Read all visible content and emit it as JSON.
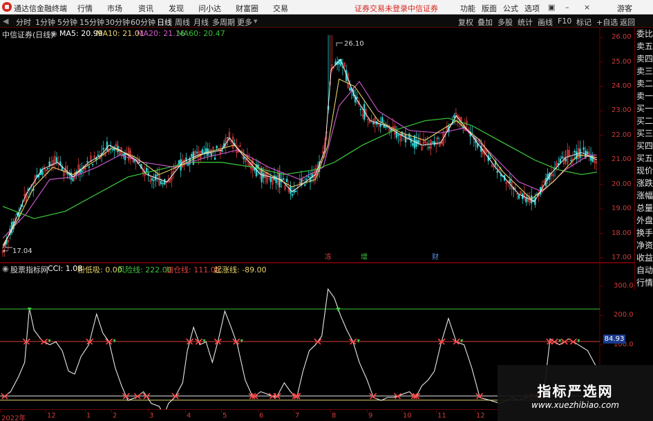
{
  "menubar": {
    "app_title": "通达信金融终端",
    "items": [
      "行情",
      "市场",
      "资讯",
      "发现",
      "问小达",
      "财富圈",
      "交易"
    ],
    "status_text": "证券交易未登录",
    "broker": "中信证券",
    "right_items": [
      "功能",
      "版面",
      "公式",
      "选项"
    ],
    "user": "游客"
  },
  "toolbar": {
    "periods": [
      "分时",
      "1分钟",
      "5分钟",
      "15分钟",
      "30分钟",
      "60分钟",
      "日线",
      "周线",
      "月线",
      "多周期",
      "更多"
    ],
    "active_period": "日线",
    "right_tools": [
      "复权",
      "叠加",
      "多股",
      "统计",
      "画线",
      "F10",
      "标记",
      "+自选",
      "返回"
    ]
  },
  "main_chart": {
    "stock_label": "中信证券(日线)",
    "ma_labels": [
      {
        "text": "MA5: 20.99",
        "color": "#ffffff"
      },
      {
        "text": "MA10: 21.01",
        "color": "#e8d36a"
      },
      {
        "text": "MA20: 21.16",
        "color": "#d25cd2"
      },
      {
        "text": "MA60: 20.47",
        "color": "#38c038"
      }
    ],
    "high_marker": "26.10",
    "low_marker": "17.04",
    "event_markers": [
      {
        "text": "冻",
        "color": "#e04040"
      },
      {
        "text": "增",
        "color": "#40c040"
      },
      {
        "text": "财",
        "color": "#5a8ce0"
      }
    ],
    "y_ticks": [
      "26.00",
      "25.00",
      "24.00",
      "23.00",
      "22.00",
      "21.00",
      "20.00",
      "19.00",
      "18.00",
      "17.00"
    ]
  },
  "sidebar": {
    "items": [
      "委比",
      "卖五",
      "卖四",
      "卖三",
      "卖二",
      "卖一",
      "买一",
      "买二",
      "买三",
      "买四",
      "买五",
      "现价",
      "涨跌",
      "涨幅",
      "总量",
      "外盘",
      "换手",
      "净资",
      "收益",
      "自动",
      "行情"
    ]
  },
  "indicator": {
    "name": "股票指标网",
    "legend": [
      {
        "text": "CCI: 1.08",
        "color": "#ffffff"
      },
      {
        "text": "粉低吸: 0.00",
        "color": "#e8d36a"
      },
      {
        "text": "风险线: 222.00",
        "color": "#40c040"
      },
      {
        "text": "加仓线: 111.00",
        "color": "#e04040"
      },
      {
        "text": "起涨线: -89.00",
        "color": "#e8d36a"
      }
    ],
    "y_ticks": [
      "300.0",
      "200.0",
      "100.0"
    ],
    "current_value": "84.93"
  },
  "date_axis": {
    "ticks": [
      "2022年",
      "12",
      "1",
      "2",
      "3",
      "4",
      "5",
      "6",
      "7",
      "8",
      "9",
      "10",
      "11",
      "12"
    ]
  },
  "watermark": {
    "title": "指标严选网",
    "url": "www.xuezhibiao.com"
  },
  "chart_data": [
    {
      "type": "candlestick",
      "title": "中信证券(日线)",
      "ylim": [
        16.8,
        26.4
      ],
      "high": 26.1,
      "low": 17.04,
      "ma5_path": [
        [
          0,
          17.4
        ],
        [
          8,
          18.5
        ],
        [
          15,
          19.6
        ],
        [
          25,
          20.6
        ],
        [
          35,
          20.9
        ],
        [
          45,
          20.3
        ],
        [
          55,
          20.9
        ],
        [
          63,
          21.2
        ],
        [
          68,
          21.6
        ],
        [
          75,
          21.4
        ],
        [
          85,
          21.0
        ],
        [
          92,
          20.4
        ],
        [
          105,
          20.1
        ],
        [
          115,
          20.9
        ],
        [
          125,
          21.2
        ],
        [
          140,
          21.4
        ],
        [
          145,
          21.9
        ],
        [
          152,
          21.3
        ],
        [
          165,
          20.4
        ],
        [
          178,
          20.2
        ],
        [
          185,
          19.7
        ],
        [
          200,
          20.4
        ],
        [
          206,
          21.4
        ],
        [
          210,
          24.7
        ],
        [
          216,
          25.1
        ],
        [
          225,
          23.6
        ],
        [
          235,
          22.6
        ],
        [
          245,
          22.4
        ],
        [
          255,
          22.0
        ],
        [
          268,
          21.6
        ],
        [
          280,
          21.7
        ],
        [
          290,
          22.8
        ],
        [
          300,
          22.0
        ],
        [
          315,
          20.7
        ],
        [
          330,
          19.6
        ],
        [
          340,
          19.3
        ],
        [
          350,
          20.4
        ],
        [
          360,
          21.1
        ],
        [
          370,
          21.3
        ],
        [
          380,
          21.0
        ]
      ],
      "ma10_path": [
        [
          0,
          17.5
        ],
        [
          10,
          18.6
        ],
        [
          20,
          19.9
        ],
        [
          32,
          20.7
        ],
        [
          45,
          20.4
        ],
        [
          60,
          21.0
        ],
        [
          70,
          21.5
        ],
        [
          85,
          21.1
        ],
        [
          100,
          20.4
        ],
        [
          115,
          20.8
        ],
        [
          130,
          21.3
        ],
        [
          148,
          21.6
        ],
        [
          165,
          20.6
        ],
        [
          185,
          19.9
        ],
        [
          200,
          20.2
        ],
        [
          208,
          21.6
        ],
        [
          215,
          24.3
        ],
        [
          225,
          24.0
        ],
        [
          240,
          22.6
        ],
        [
          255,
          22.1
        ],
        [
          270,
          21.8
        ],
        [
          290,
          22.6
        ],
        [
          305,
          21.8
        ],
        [
          320,
          20.5
        ],
        [
          338,
          19.4
        ],
        [
          352,
          20.1
        ],
        [
          368,
          21.2
        ],
        [
          380,
          21.1
        ]
      ],
      "ma20_path": [
        [
          0,
          17.8
        ],
        [
          15,
          18.8
        ],
        [
          30,
          20.2
        ],
        [
          45,
          20.3
        ],
        [
          60,
          20.7
        ],
        [
          75,
          21.2
        ],
        [
          90,
          20.9
        ],
        [
          110,
          20.7
        ],
        [
          130,
          21.1
        ],
        [
          150,
          21.4
        ],
        [
          170,
          20.7
        ],
        [
          190,
          20.2
        ],
        [
          205,
          20.7
        ],
        [
          215,
          23.2
        ],
        [
          228,
          24.2
        ],
        [
          240,
          23.0
        ],
        [
          260,
          22.2
        ],
        [
          280,
          22.1
        ],
        [
          295,
          22.3
        ],
        [
          310,
          21.4
        ],
        [
          330,
          20.1
        ],
        [
          345,
          19.7
        ],
        [
          360,
          20.6
        ],
        [
          375,
          21.2
        ],
        [
          380,
          21.2
        ]
      ],
      "ma60_path": [
        [
          0,
          19.1
        ],
        [
          20,
          18.6
        ],
        [
          40,
          18.9
        ],
        [
          60,
          19.6
        ],
        [
          80,
          20.3
        ],
        [
          100,
          20.6
        ],
        [
          120,
          20.9
        ],
        [
          140,
          20.9
        ],
        [
          160,
          20.7
        ],
        [
          180,
          20.4
        ],
        [
          200,
          20.6
        ],
        [
          212,
          20.9
        ],
        [
          230,
          21.6
        ],
        [
          250,
          22.2
        ],
        [
          270,
          22.6
        ],
        [
          285,
          22.7
        ],
        [
          300,
          22.4
        ],
        [
          320,
          21.7
        ],
        [
          340,
          21.0
        ],
        [
          355,
          20.6
        ],
        [
          370,
          20.4
        ],
        [
          380,
          20.5
        ]
      ]
    },
    {
      "type": "line",
      "title": "CCI",
      "ylim": [
        -120,
        380
      ],
      "risk_line": 222,
      "add_line": 111,
      "start_line": -89,
      "cci_path": [
        [
          0,
          -80
        ],
        [
          5,
          -60
        ],
        [
          10,
          -10
        ],
        [
          14,
          40
        ],
        [
          17,
          225
        ],
        [
          20,
          150
        ],
        [
          25,
          115
        ],
        [
          30,
          100
        ],
        [
          34,
          110
        ],
        [
          38,
          80
        ],
        [
          42,
          10
        ],
        [
          46,
          0
        ],
        [
          50,
          60
        ],
        [
          55,
          100
        ],
        [
          60,
          205
        ],
        [
          64,
          140
        ],
        [
          68,
          110
        ],
        [
          72,
          20
        ],
        [
          76,
          -40
        ],
        [
          80,
          -90
        ],
        [
          85,
          -80
        ],
        [
          90,
          -60
        ],
        [
          95,
          -100
        ],
        [
          100,
          -110
        ],
        [
          103,
          -140
        ],
        [
          106,
          -100
        ],
        [
          110,
          -80
        ],
        [
          115,
          -30
        ],
        [
          118,
          80
        ],
        [
          122,
          160
        ],
        [
          126,
          100
        ],
        [
          130,
          110
        ],
        [
          134,
          40
        ],
        [
          138,
          120
        ],
        [
          142,
          215
        ],
        [
          146,
          160
        ],
        [
          150,
          100
        ],
        [
          155,
          -20
        ],
        [
          160,
          -80
        ],
        [
          165,
          -60
        ],
        [
          170,
          -70
        ],
        [
          175,
          -80
        ],
        [
          180,
          -30
        ],
        [
          184,
          -60
        ],
        [
          188,
          -80
        ],
        [
          192,
          10
        ],
        [
          196,
          80
        ],
        [
          200,
          100
        ],
        [
          204,
          130
        ],
        [
          208,
          290
        ],
        [
          212,
          260
        ],
        [
          216,
          200
        ],
        [
          220,
          150
        ],
        [
          224,
          110
        ],
        [
          228,
          40
        ],
        [
          233,
          -20
        ],
        [
          237,
          -80
        ],
        [
          242,
          -90
        ],
        [
          246,
          -80
        ],
        [
          250,
          -80
        ],
        [
          255,
          -70
        ],
        [
          260,
          -60
        ],
        [
          264,
          -80
        ],
        [
          268,
          -40
        ],
        [
          272,
          -20
        ],
        [
          276,
          10
        ],
        [
          280,
          100
        ],
        [
          285,
          190
        ],
        [
          290,
          110
        ],
        [
          295,
          100
        ],
        [
          300,
          20
        ],
        [
          305,
          -80
        ],
        [
          312,
          -90
        ],
        [
          318,
          -100
        ],
        [
          322,
          -90
        ],
        [
          326,
          -80
        ],
        [
          330,
          -90
        ],
        [
          334,
          -80
        ],
        [
          338,
          -70
        ],
        [
          342,
          -80
        ],
        [
          346,
          -60
        ],
        [
          350,
          120
        ],
        [
          356,
          100
        ],
        [
          362,
          120
        ],
        [
          368,
          100
        ],
        [
          374,
          80
        ],
        [
          380,
          20
        ]
      ]
    }
  ]
}
